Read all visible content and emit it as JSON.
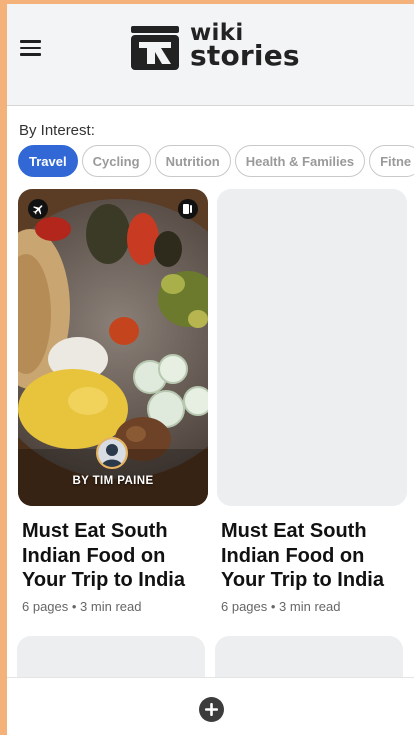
{
  "header": {
    "logo_line1": "wiki",
    "logo_line2": "stories"
  },
  "filters": {
    "label": "By Interest:",
    "chips": [
      {
        "label": "Travel",
        "active": true
      },
      {
        "label": "Cycling",
        "active": false
      },
      {
        "label": "Nutrition",
        "active": false
      },
      {
        "label": "Health & Families",
        "active": false
      },
      {
        "label": "Fitne",
        "active": false
      }
    ]
  },
  "stories": [
    {
      "title": "Must Eat South Indian Food on Your Trip to India",
      "meta": "6 pages • 3 min read",
      "byline": "BY TIM PAINE",
      "category_icon": "airplane-icon",
      "type_icon": "story-pages-icon",
      "has_image": true
    },
    {
      "title": "Must Eat South Indian Food on Your Trip to India",
      "meta": "6 pages • 3 min read",
      "has_image": false
    }
  ],
  "colors": {
    "accent": "#3168d6",
    "page_border": "#f4b27a",
    "placeholder": "#eceef0"
  },
  "bottom_bar": {
    "add_icon": "plus-circle-icon"
  }
}
